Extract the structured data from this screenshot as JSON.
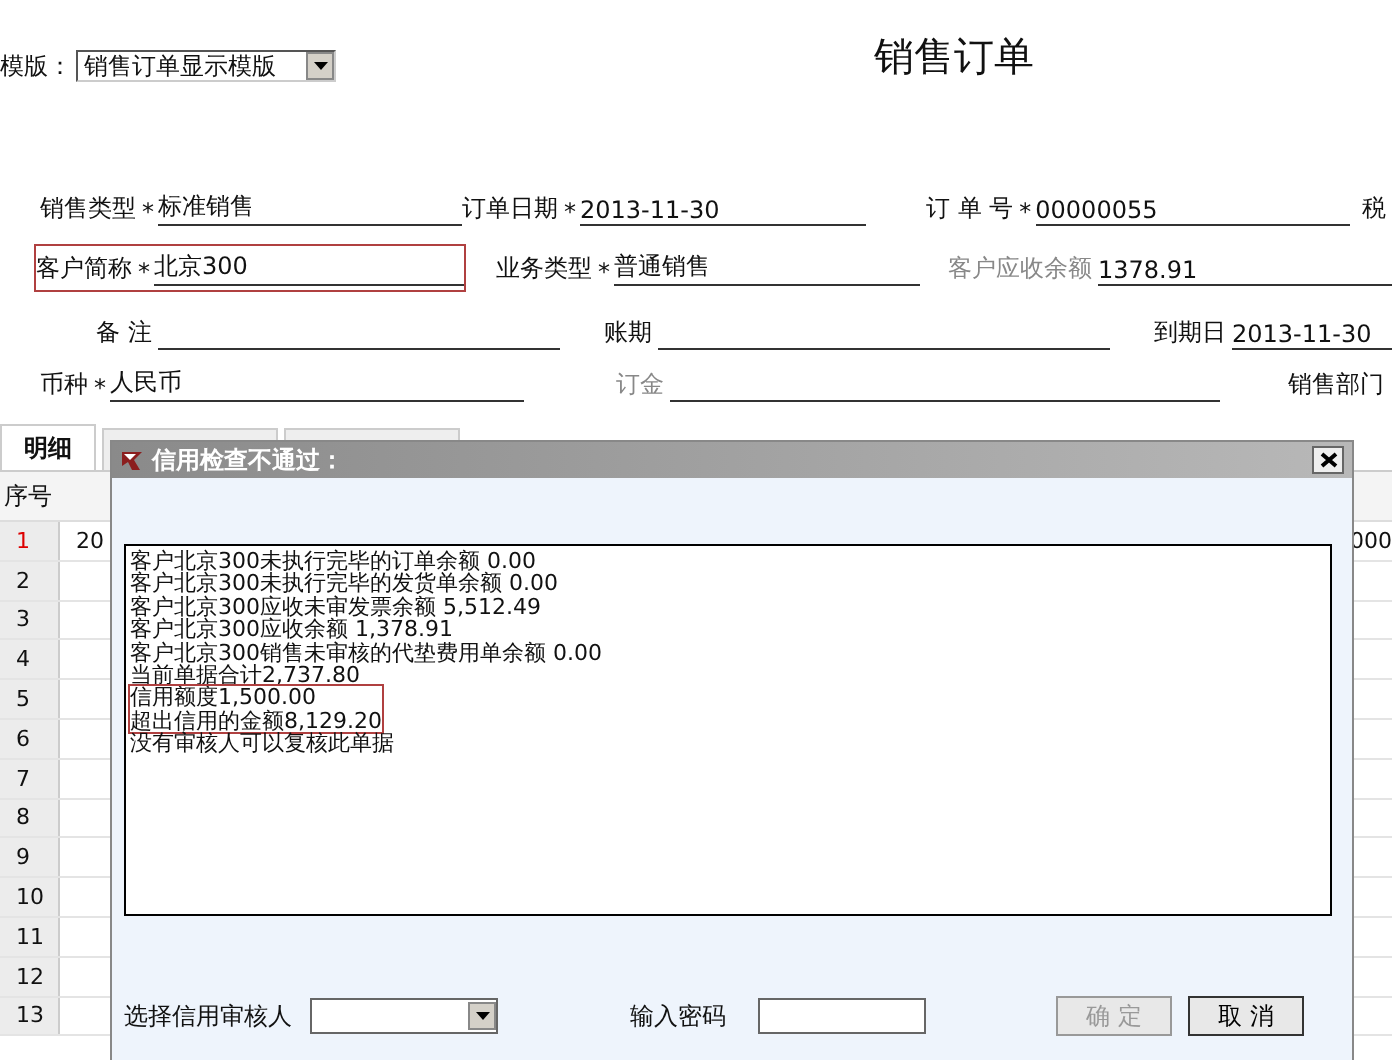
{
  "toolbar": {
    "template_label": "模版：",
    "template_value": "销售订单显示模版"
  },
  "title": "销售订单",
  "form_rows": [
    [
      {
        "label": "销售类型",
        "mark": "*",
        "value": "标准销售",
        "disabled": false,
        "highlighted": false
      },
      {
        "label": "订单日期",
        "mark": "*",
        "value": "2013-11-30",
        "disabled": false,
        "highlighted": false
      },
      {
        "label": "订 单 号",
        "mark": "*",
        "value": "00000055",
        "disabled": false,
        "highlighted": false
      },
      {
        "label": "税",
        "disabled": false,
        "highlighted": false
      }
    ],
    [
      {
        "label": "客户简称",
        "mark": "*",
        "value": "北京300",
        "disabled": false,
        "highlighted": true
      },
      {
        "label": "业务类型",
        "mark": "*",
        "value": "普通销售",
        "disabled": false,
        "highlighted": false
      },
      {
        "label": "客户应收余额",
        "value": "1378.91",
        "disabled": true,
        "highlighted": false
      }
    ],
    [
      {
        "label": "备 注",
        "disabled": false,
        "highlighted": false
      },
      {
        "label": "账期",
        "disabled": false,
        "highlighted": false
      },
      {
        "label": "到期日",
        "value": "2013-11-30",
        "disabled": false,
        "highlighted": false
      }
    ],
    [
      {
        "label": "币种",
        "mark": "*",
        "value": "人民币",
        "disabled": false,
        "highlighted": false
      },
      {
        "label": "订金",
        "disabled": true,
        "highlighted": false
      },
      {
        "label": "销售部门",
        "disabled": false,
        "highlighted": false
      }
    ]
  ],
  "tabs": [
    {
      "label": "明细",
      "selected": true
    },
    {
      "selected": false
    },
    {
      "selected": false
    }
  ],
  "grid": {
    "header": "序号",
    "rows": [
      {
        "number": "1",
        "selected": true,
        "cells": [
          "20",
          "000"
        ]
      },
      {
        "number": "2",
        "selected": false
      },
      {
        "number": "3",
        "selected": false
      },
      {
        "number": "4",
        "selected": false
      },
      {
        "number": "5",
        "selected": false
      },
      {
        "number": "6",
        "selected": false
      },
      {
        "number": "7",
        "selected": false
      },
      {
        "number": "8",
        "selected": false
      },
      {
        "number": "9",
        "selected": false
      },
      {
        "number": "10",
        "selected": false
      },
      {
        "number": "11",
        "selected": false
      },
      {
        "number": "12",
        "selected": false
      },
      {
        "number": "13",
        "selected": false
      }
    ]
  },
  "dialog": {
    "title": "信用检查不通过：",
    "messages": [
      {
        "text": "客户北京300未执行完毕的订单余额 0.00",
        "highlighted": false
      },
      {
        "text": "客户北京300未执行完毕的发货单余额 0.00",
        "highlighted": false
      },
      {
        "text": "客户北京300应收未审发票余额 5,512.49",
        "highlighted": false
      },
      {
        "text": "客户北京300应收余额 1,378.91",
        "highlighted": false
      },
      {
        "text": "客户北京300销售未审核的代垫费用单余额 0.00",
        "highlighted": false
      },
      {
        "text": "当前单据合计2,737.80",
        "highlighted": false
      },
      {
        "text": "信用额度1,500.00",
        "highlighted": true
      },
      {
        "text": "超出信用的金额8,129.20",
        "highlighted": true
      },
      {
        "text": "没有审核人可以复核此单据",
        "highlighted": false
      }
    ],
    "approver_label": "选择信用审核人",
    "password_label": "输入密码",
    "buttons": [
      {
        "label": "确 定",
        "disabled": true
      },
      {
        "label": "取 消",
        "disabled": false
      }
    ]
  }
}
